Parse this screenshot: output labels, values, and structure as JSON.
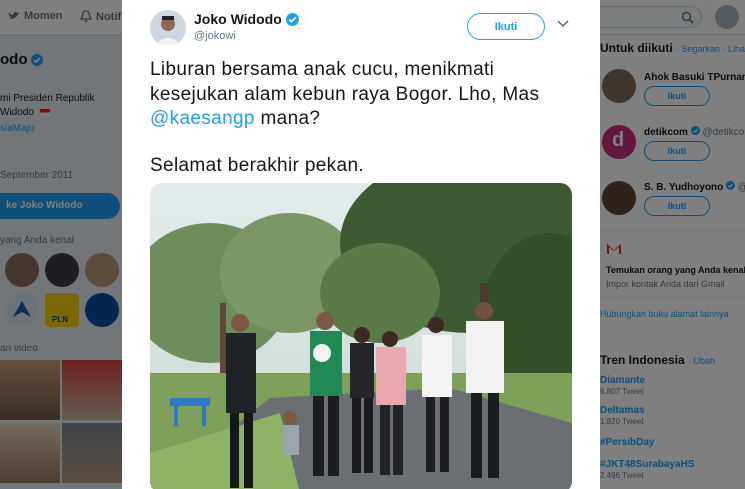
{
  "topbar": {
    "nav_home": "Momen",
    "nav_notif": "Notif"
  },
  "profile": {
    "name": "odo",
    "bio_line1": "mi Presiden Republik",
    "bio_line2": "Widodo",
    "bio_line3": "siaMaju",
    "joined": "September 2011",
    "tweet_to": "ke Joko Widodo",
    "known_label": "yang Anda kenal",
    "videos_label": "an video",
    "pln_label": "PLN"
  },
  "who_to_follow": {
    "title": "Untuk diikuti",
    "refresh": "· Segarkan · Lihat",
    "items": [
      {
        "name": "Ahok Basuki TPurnama",
        "handle": "",
        "button": "Ikuti"
      },
      {
        "name": "detikcom",
        "handle": "@detikcom",
        "button": "Ikuti"
      },
      {
        "name": "S. B. Yudhoyono",
        "handle": "@S",
        "button": "Ikuti"
      }
    ],
    "find_title": "Temukan orang yang Anda kenal",
    "find_sub": "Impor kontak Anda dari Gmail",
    "address_book": "Hubungkan buku alamat lainnya"
  },
  "trends": {
    "title": "Tren Indonesia",
    "change": "· Ubah",
    "items": [
      {
        "tag": "Diamante",
        "count": "6.807 Tweet"
      },
      {
        "tag": "Deltamas",
        "count": "1.820 Tweet"
      },
      {
        "tag": "#PersibDay",
        "count": ""
      },
      {
        "tag": "#JKT48SurabayaHS",
        "count": "2.496 Tweet"
      }
    ]
  },
  "tweet": {
    "name": "Joko Widodo",
    "handle": "@jokowi",
    "follow_label": "Ikuti",
    "text_line1": "Liburan bersama anak cucu, menikmati",
    "text_line2": "kesejukan alam kebun raya Bogor. Lho, Mas",
    "mention": "@kaesangp",
    "text_line3_rest": " mana?",
    "text_line4": "Selamat berakhir pekan."
  },
  "colors": {
    "accent": "#1da1f2",
    "verified": "#1da1f2",
    "text": "#14171a",
    "muted": "#657786"
  }
}
